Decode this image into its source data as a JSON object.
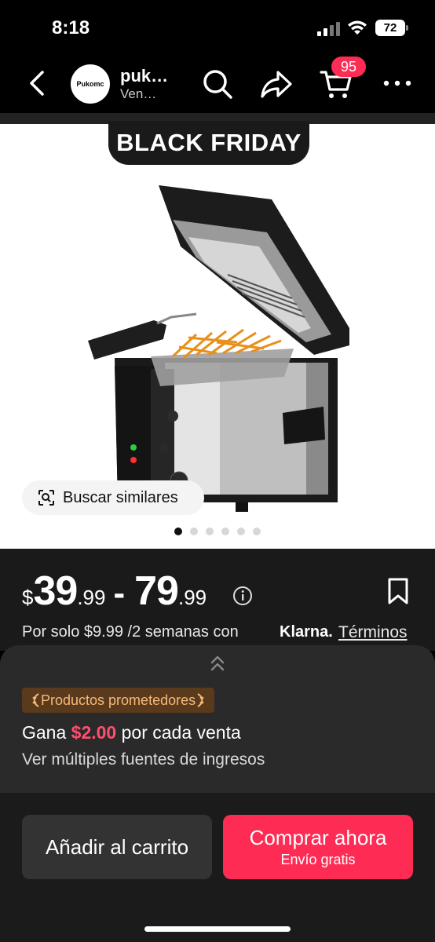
{
  "status_bar": {
    "time": "8:18",
    "battery": "72"
  },
  "nav": {
    "shop_logo_text": "Pukomc",
    "shop_name": "puk…",
    "shop_subtitle": "Ven…",
    "cart_count": "95"
  },
  "hero": {
    "banner": "BLACK FRIDAY",
    "similar_label": "Buscar similares",
    "image_count": 6,
    "active_index": 0
  },
  "price": {
    "currency": "$",
    "low_int": "39",
    "low_cents": ".99",
    "separator": "-",
    "high_int": "79",
    "high_cents": ".99",
    "installment": "Por solo $9.99 /2 semanas con",
    "klarna": "Klarna.",
    "terms": "Términos"
  },
  "earn": {
    "badge": "Productos prometedores",
    "prefix": "Gana",
    "amount": "$2.00",
    "suffix": "por cada venta",
    "sources": "Ver múltiples fuentes de ingresos"
  },
  "actions": {
    "add_to_cart": "Añadir al carrito",
    "buy_now": "Comprar ahora",
    "free_shipping": "Envío gratis"
  },
  "colors": {
    "accent": "#fe2c55",
    "earn_amount": "#fe4e6e",
    "badge_text": "#f7b97a"
  }
}
